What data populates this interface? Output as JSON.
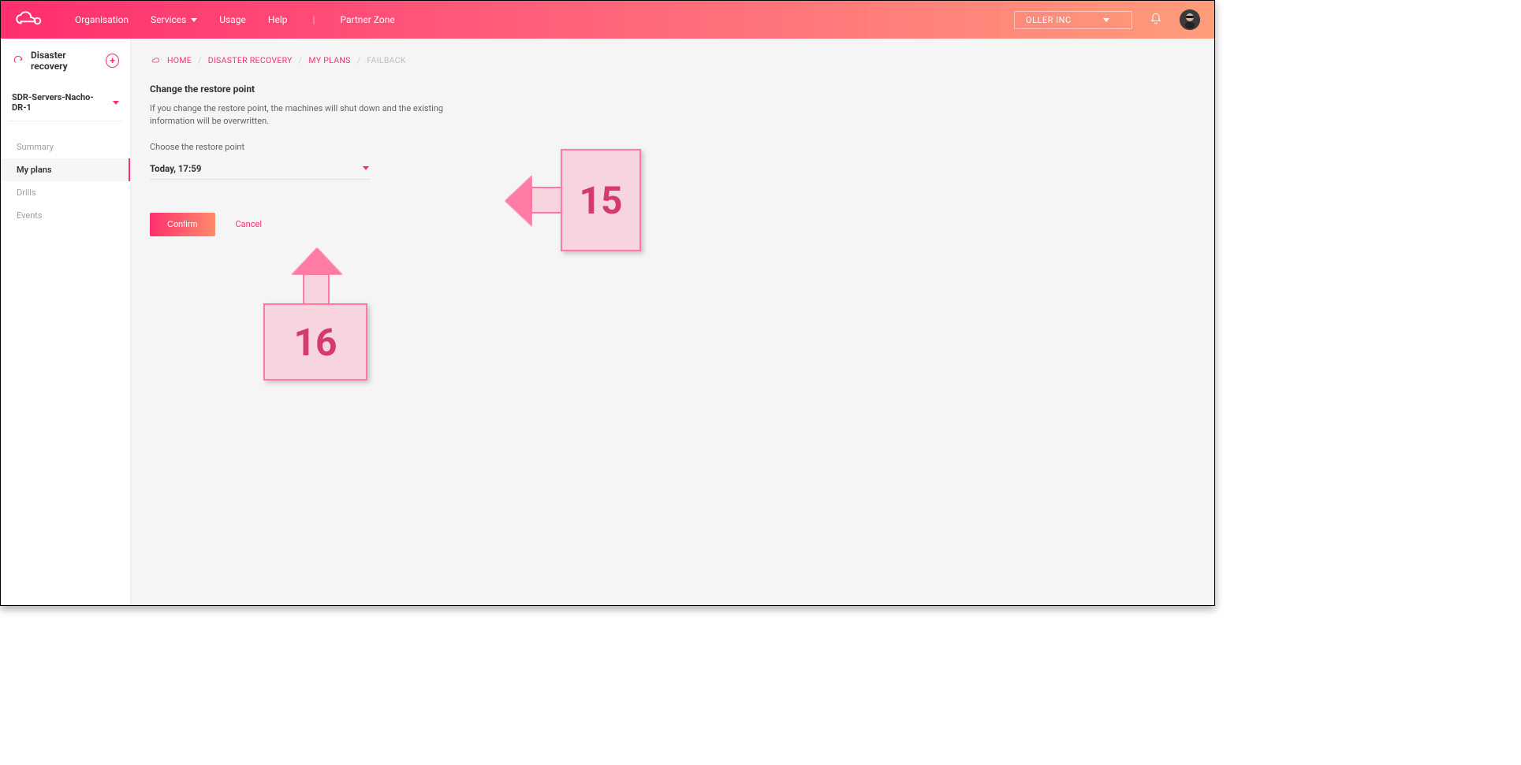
{
  "topnav": {
    "organisation": "Organisation",
    "services": "Services",
    "usage": "Usage",
    "help": "Help",
    "partner_zone": "Partner Zone"
  },
  "org_selector": {
    "label": "OLLER INC"
  },
  "sidebar": {
    "title": "Disaster recovery",
    "server_name": "SDR-Servers-Nacho-DR-1",
    "items": [
      {
        "label": "Summary"
      },
      {
        "label": "My plans"
      },
      {
        "label": "Drills"
      },
      {
        "label": "Events"
      }
    ],
    "active_index": 1
  },
  "breadcrumb": {
    "home": "HOME",
    "dr": "DISASTER RECOVERY",
    "myplans": "MY PLANS",
    "failback": "FAILBACK"
  },
  "panel": {
    "title": "Change the restore point",
    "description": "If you change the restore point, the machines will shut down and the existing information will be overwritten.",
    "field_label": "Choose the restore point",
    "selected_value": "Today, 17:59",
    "confirm_label": "Confirm",
    "cancel_label": "Cancel"
  },
  "annotations": {
    "a15": "15",
    "a16": "16"
  }
}
